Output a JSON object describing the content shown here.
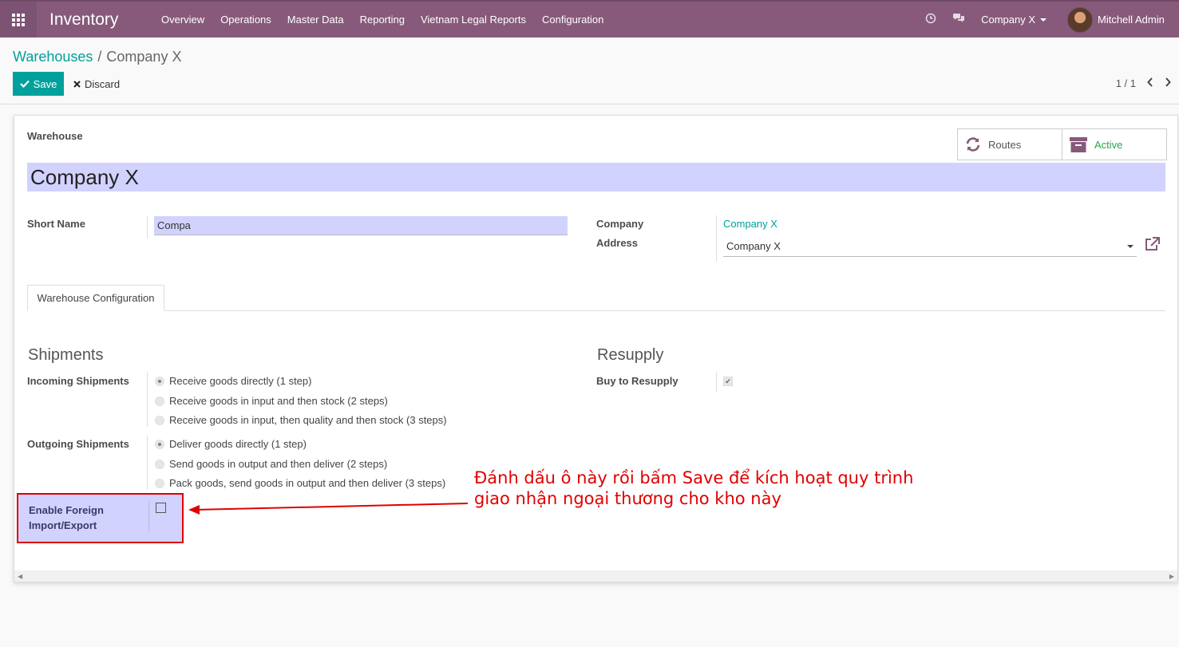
{
  "navbar": {
    "app_title": "Inventory",
    "menu": [
      "Overview",
      "Operations",
      "Master Data",
      "Reporting",
      "Vietnam Legal Reports",
      "Configuration"
    ],
    "company": "Company X",
    "user": "Mitchell Admin"
  },
  "breadcrumb": {
    "parent": "Warehouses",
    "separator": "/",
    "current": "Company X"
  },
  "actions": {
    "save": "Save",
    "discard": "Discard"
  },
  "pager": {
    "value": "1 / 1"
  },
  "form": {
    "warehouse_label": "Warehouse",
    "name": "Company X",
    "routes_label": "Routes",
    "active_label": "Active",
    "short_name_label": "Short Name",
    "short_name_value": "Compa",
    "company_label": "Company",
    "company_value": "Company X",
    "address_label": "Address",
    "address_value": "Company X",
    "tab_label": "Warehouse Configuration",
    "shipments_title": "Shipments",
    "incoming_label": "Incoming Shipments",
    "incoming_options": [
      "Receive goods directly (1 step)",
      "Receive goods in input and then stock (2 steps)",
      "Receive goods in input, then quality and then stock (3 steps)"
    ],
    "incoming_selected": 0,
    "outgoing_label": "Outgoing Shipments",
    "outgoing_options": [
      "Deliver goods directly (1 step)",
      "Send goods in output and then deliver (2 steps)",
      "Pack goods, send goods in output and then deliver (3 steps)"
    ],
    "outgoing_selected": 0,
    "foreign_label_line1": "Enable Foreign",
    "foreign_label_line2": "Import/Export",
    "foreign_checked": false,
    "resupply_title": "Resupply",
    "buy_label": "Buy to Resupply",
    "buy_checked": true
  },
  "annotation": {
    "line1": "Đánh dấu ô này rồi bấm Save để kích hoạt quy trình",
    "line2": "giao nhận ngoại thương cho kho này",
    "color": "#e00000"
  },
  "colors": {
    "brand": "#875a7b",
    "accent": "#00a09d",
    "required_field": "#d2d2ff"
  }
}
